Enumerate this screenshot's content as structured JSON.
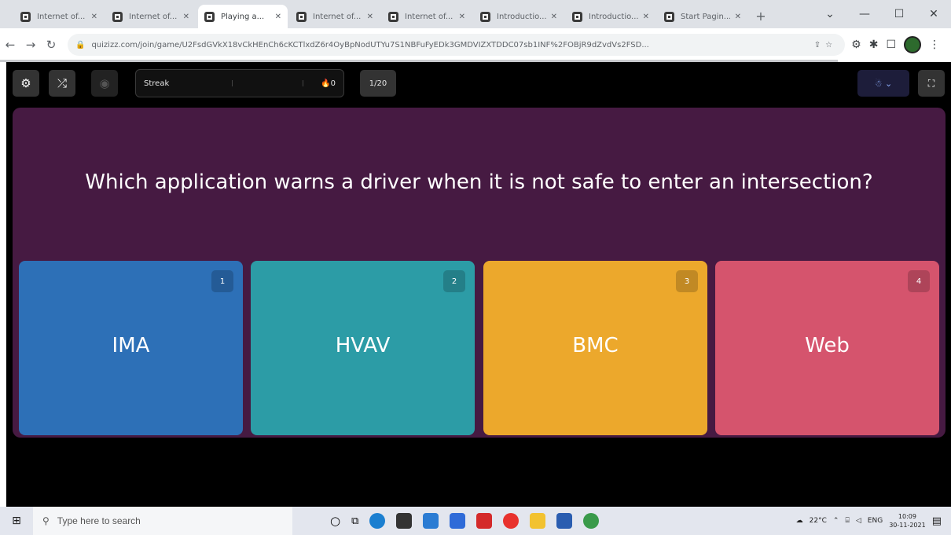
{
  "browser": {
    "tabs": [
      {
        "title": "Internet of...",
        "active": false
      },
      {
        "title": "Internet of...",
        "active": false
      },
      {
        "title": "Playing a...",
        "active": true
      },
      {
        "title": "Internet of...",
        "active": false
      },
      {
        "title": "Internet of...",
        "active": false
      },
      {
        "title": "Introductio...",
        "active": false
      },
      {
        "title": "Introductio...",
        "active": false
      },
      {
        "title": "Start Pagin...",
        "active": false
      }
    ],
    "url": "quizizz.com/join/game/U2FsdGVkX18vCkHEnCh6cKCTlxdZ6r4OyBpNodUTYu7S1NBFuFyEDk3GMDVIZXTDDC07sb1INF%2FOBjR9dZvdVs2FSD..."
  },
  "quiz": {
    "streak_label": "Streak",
    "streak_count": "0",
    "question_counter": "1/20",
    "question": "Which application warns a driver when it is not safe to enter an intersection?",
    "options": [
      {
        "number": "1",
        "text": "IMA",
        "color": "#2d70b7"
      },
      {
        "number": "2",
        "text": "HVAV",
        "color": "#2c9ca6"
      },
      {
        "number": "3",
        "text": "BMC",
        "color": "#eca82c"
      },
      {
        "number": "4",
        "text": "Web",
        "color": "#d5546d"
      }
    ]
  },
  "taskbar": {
    "search_placeholder": "Type here to search",
    "weather": "22°C",
    "language": "ENG",
    "time": "10:09",
    "date": "30-11-2021"
  },
  "colors": {
    "question_panel": "#461a42",
    "app_background": "#000000"
  }
}
